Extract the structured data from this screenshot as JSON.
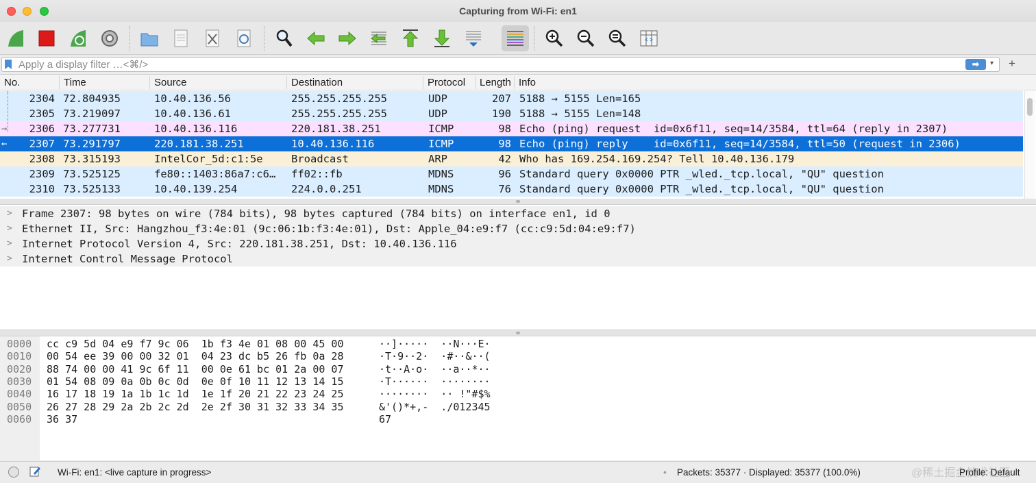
{
  "window": {
    "title": "Capturing from Wi-Fi: en1"
  },
  "toolbar": {
    "buttons": [
      {
        "name": "start-capture-icon"
      },
      {
        "name": "stop-capture-icon"
      },
      {
        "name": "restart-capture-icon"
      },
      {
        "name": "capture-options-icon"
      },
      {
        "name": "open-file-icon"
      },
      {
        "name": "save-file-icon"
      },
      {
        "name": "close-file-icon"
      },
      {
        "name": "reload-file-icon"
      },
      {
        "name": "find-packet-icon"
      },
      {
        "name": "go-back-icon"
      },
      {
        "name": "go-forward-icon"
      },
      {
        "name": "go-to-packet-icon"
      },
      {
        "name": "go-first-packet-icon"
      },
      {
        "name": "go-last-packet-icon"
      },
      {
        "name": "autoscroll-icon"
      },
      {
        "name": "colorize-icon"
      },
      {
        "name": "zoom-in-icon"
      },
      {
        "name": "zoom-out-icon"
      },
      {
        "name": "normal-size-icon"
      },
      {
        "name": "resize-columns-icon"
      }
    ]
  },
  "filter": {
    "placeholder": "Apply a display filter …<⌘/>",
    "value": "",
    "apply_label": "➡",
    "dropdown_label": "▾",
    "add_label": "+"
  },
  "packet_list": {
    "columns": [
      "No.",
      "Time",
      "Source",
      "Destination",
      "Protocol",
      "Length",
      "Info"
    ],
    "colors": {
      "udp": "#daeeff",
      "icmp": "#fce0ff",
      "arp": "#faf0d7",
      "selected": "#0d6fd8"
    },
    "rows": [
      {
        "no": "2304",
        "time": "72.804935",
        "src": "10.40.136.56",
        "dst": "255.255.255.255",
        "proto": "UDP",
        "len": "207",
        "info": "5188 → 5155 Len=165",
        "color": "udp",
        "rel": ""
      },
      {
        "no": "2305",
        "time": "73.219097",
        "src": "10.40.136.61",
        "dst": "255.255.255.255",
        "proto": "UDP",
        "len": "190",
        "info": "5188 → 5155 Len=148",
        "color": "udp",
        "rel": ""
      },
      {
        "no": "2306",
        "time": "73.277731",
        "src": "10.40.136.116",
        "dst": "220.181.38.251",
        "proto": "ICMP",
        "len": "98",
        "info": "Echo (ping) request  id=0x6f11, seq=14/3584, ttl=64 (reply in 2307)",
        "color": "icmp",
        "rel": "→"
      },
      {
        "no": "2307",
        "time": "73.291797",
        "src": "220.181.38.251",
        "dst": "10.40.136.116",
        "proto": "ICMP",
        "len": "98",
        "info": "Echo (ping) reply    id=0x6f11, seq=14/3584, ttl=50 (request in 2306)",
        "color": "selected",
        "rel": "←"
      },
      {
        "no": "2308",
        "time": "73.315193",
        "src": "IntelCor_5d:c1:5e",
        "dst": "Broadcast",
        "proto": "ARP",
        "len": "42",
        "info": "Who has 169.254.169.254? Tell 10.40.136.179",
        "color": "arp",
        "rel": ""
      },
      {
        "no": "2309",
        "time": "73.525125",
        "src": "fe80::1403:86a7:c6…",
        "dst": "ff02::fb",
        "proto": "MDNS",
        "len": "96",
        "info": "Standard query 0x0000 PTR _wled._tcp.local, \"QU\" question",
        "color": "udp",
        "rel": ""
      },
      {
        "no": "2310",
        "time": "73.525133",
        "src": "10.40.139.254",
        "dst": "224.0.0.251",
        "proto": "MDNS",
        "len": "76",
        "info": "Standard query 0x0000 PTR _wled._tcp.local, \"QU\" question",
        "color": "udp",
        "rel": ""
      }
    ]
  },
  "details": [
    "Frame 2307: 98 bytes on wire (784 bits), 98 bytes captured (784 bits) on interface en1, id 0",
    "Ethernet II, Src: Hangzhou_f3:4e:01 (9c:06:1b:f3:4e:01), Dst: Apple_04:e9:f7 (cc:c9:5d:04:e9:f7)",
    "Internet Protocol Version 4, Src: 220.181.38.251, Dst: 10.40.136.116",
    "Internet Control Message Protocol"
  ],
  "bytes": [
    {
      "off": "0000",
      "hex": "cc c9 5d 04 e9 f7 9c 06  1b f3 4e 01 08 00 45 00",
      "ascii": "··]·····  ··N···E·"
    },
    {
      "off": "0010",
      "hex": "00 54 ee 39 00 00 32 01  04 23 dc b5 26 fb 0a 28",
      "ascii": "·T·9··2·  ·#··&··("
    },
    {
      "off": "0020",
      "hex": "88 74 00 00 41 9c 6f 11  00 0e 61 bc 01 2a 00 07",
      "ascii": "·t··A·o·  ··a··*··"
    },
    {
      "off": "0030",
      "hex": "01 54 08 09 0a 0b 0c 0d  0e 0f 10 11 12 13 14 15",
      "ascii": "·T······  ········"
    },
    {
      "off": "0040",
      "hex": "16 17 18 19 1a 1b 1c 1d  1e 1f 20 21 22 23 24 25",
      "ascii": "········  ·· !\"#$%"
    },
    {
      "off": "0050",
      "hex": "26 27 28 29 2a 2b 2c 2d  2e 2f 30 31 32 33 34 35",
      "ascii": "&'()*+,-  ./012345"
    },
    {
      "off": "0060",
      "hex": "36 37",
      "ascii": "67"
    }
  ],
  "status": {
    "capture": "Wi-Fi: en1: <live capture in progress>",
    "separator": "•",
    "packets": "Packets: 35377 · Displayed: 35377 (100.0%)",
    "profile": "Profile: Default",
    "watermark": "@稀土掘金技术社区"
  }
}
